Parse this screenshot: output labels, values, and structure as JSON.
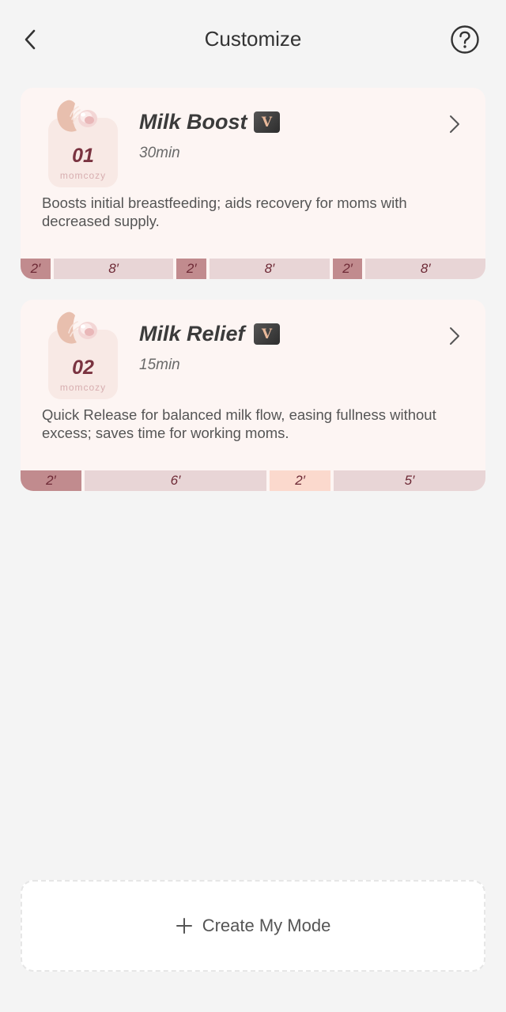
{
  "header": {
    "title": "Customize"
  },
  "modes": [
    {
      "number": "01",
      "brand": "momcozy",
      "name": "Milk Boost",
      "vip_badge": "V",
      "duration": "30min",
      "description": "Boosts initial breastfeeding; aids recovery for moms with decreased supply.",
      "segments": [
        {
          "label": "2′",
          "style": "dark",
          "minutes": 2
        },
        {
          "label": "8′",
          "style": "light",
          "minutes": 8
        },
        {
          "label": "2′",
          "style": "dark",
          "minutes": 2
        },
        {
          "label": "8′",
          "style": "light",
          "minutes": 8
        },
        {
          "label": "2′",
          "style": "dark",
          "minutes": 2
        },
        {
          "label": "8′",
          "style": "light",
          "minutes": 8
        }
      ]
    },
    {
      "number": "02",
      "brand": "momcozy",
      "name": "Milk Relief",
      "vip_badge": "V",
      "duration": "15min",
      "description": "Quick Release for balanced milk flow, easing fullness without excess; saves time for working moms.",
      "segments": [
        {
          "label": "2′",
          "style": "dark",
          "minutes": 2
        },
        {
          "label": "6′",
          "style": "light",
          "minutes": 6
        },
        {
          "label": "2′",
          "style": "peach",
          "minutes": 2
        },
        {
          "label": "5′",
          "style": "light",
          "minutes": 5
        }
      ]
    }
  ],
  "create": {
    "label": "Create My Mode"
  },
  "colors": {
    "background": "#f4f4f4",
    "card": "#fdf5f3",
    "segment_dark": "#c18b8e",
    "segment_light": "#e8d5d6",
    "segment_peach": "#fbd9cd",
    "accent_text": "#6e2a36"
  },
  "icons": {
    "back": "chevron-left-icon",
    "help": "help-circle-icon",
    "chevron": "chevron-right-icon",
    "plus": "plus-icon"
  }
}
